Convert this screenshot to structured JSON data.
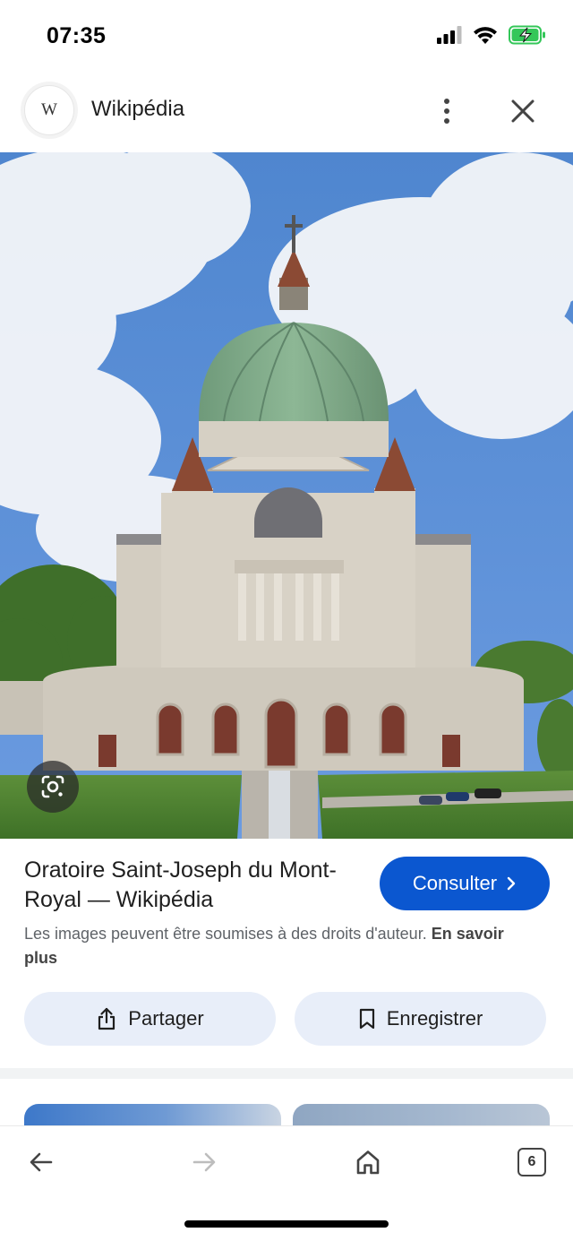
{
  "status_bar": {
    "time": "07:35"
  },
  "header": {
    "logo_letter": "W",
    "site_name": "Wikipédia"
  },
  "result": {
    "title": "Oratoire Saint-Joseph du Mont-Royal — Wikipédia",
    "consult_label": "Consulter",
    "copyright_text": "Les images peuvent être soumises à des droits d'auteur.",
    "learn_more_label": "En savoir plus"
  },
  "actions": {
    "share_label": "Partager",
    "save_label": "Enregistrer"
  },
  "browser_nav": {
    "tab_count": "6"
  },
  "icons": {
    "back": "arrow-left-icon",
    "forward": "arrow-right-icon",
    "home": "home-icon",
    "tabs": "tab-switcher-icon",
    "lens": "google-lens-icon",
    "share": "share-icon",
    "bookmark": "bookmark-icon",
    "more": "more-vert-icon",
    "close": "close-icon"
  },
  "colors": {
    "accent": "#0b57d0",
    "action_bg": "#e8eef9",
    "battery": "#34c759"
  }
}
